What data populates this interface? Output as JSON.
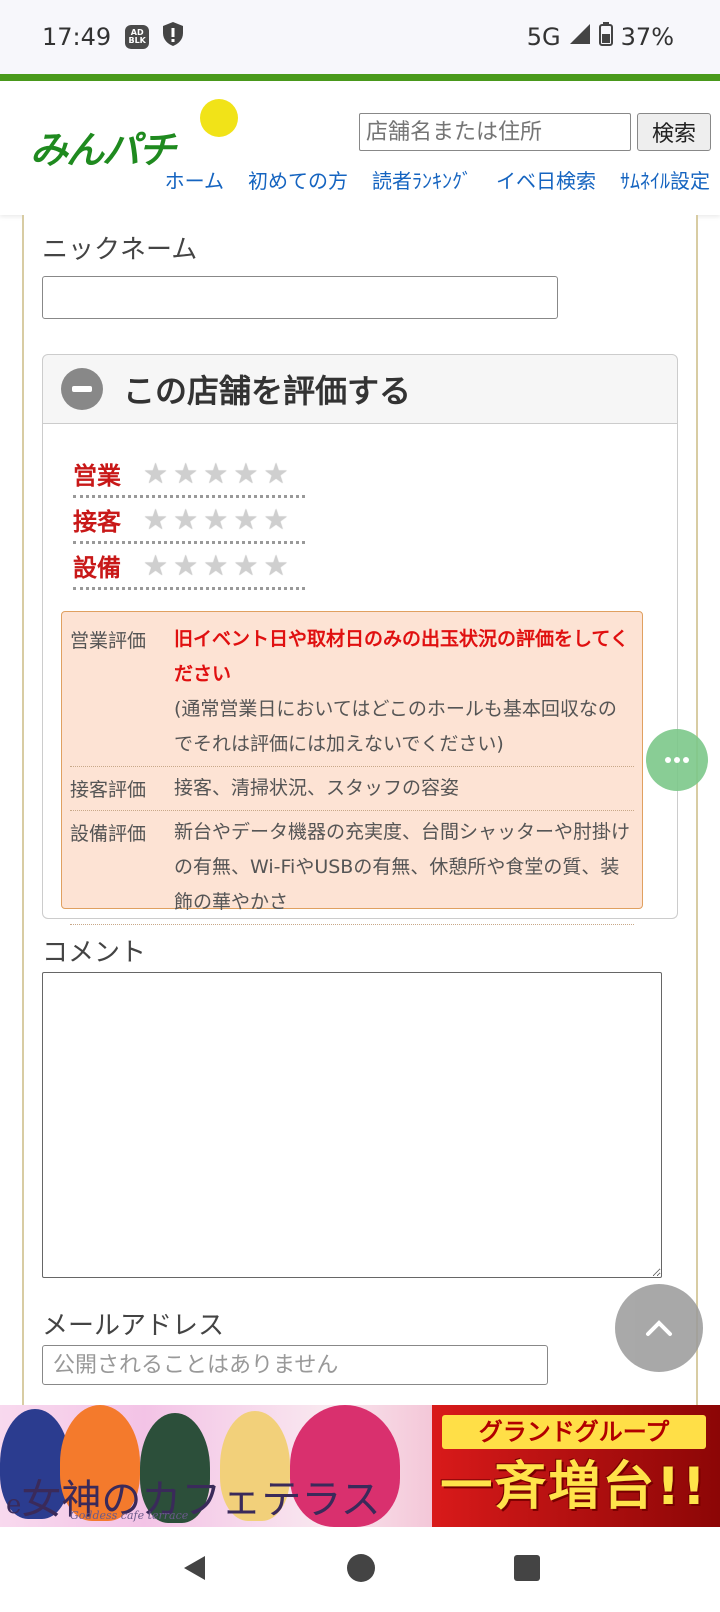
{
  "status_bar": {
    "time": "17:49",
    "network": "5G",
    "battery": "37%",
    "icons": [
      "ad-blocker-icon",
      "shield-icon",
      "signal-icon",
      "battery-icon"
    ]
  },
  "header": {
    "logo_text": "みんパチ",
    "search": {
      "placeholder": "店舗名または住所",
      "button_label": "検索"
    },
    "nav": [
      "ホーム",
      "初めての方",
      "読者ﾗﾝｷﾝｸﾞ",
      "イベ日検索",
      "ｻﾑﾈｲﾙ設定"
    ]
  },
  "form": {
    "nickname_label": "ニックネーム",
    "nickname_value": "",
    "rating_section": {
      "title": "この店舗を評価する",
      "rows": [
        {
          "label": "営業",
          "stars": 0,
          "max": 5
        },
        {
          "label": "接客",
          "stars": 0,
          "max": 5
        },
        {
          "label": "設備",
          "stars": 0,
          "max": 5
        }
      ],
      "guide": {
        "eigyo_key": "営業評価",
        "eigyo_highlight": "旧イベント日や取材日のみの出玉状況の評価をしてください",
        "eigyo_note": "(通常営業日においてはどこのホールも基本回収なのでそれは評価には加えないでください)",
        "sekkyaku_key": "接客評価",
        "sekkyaku_value": "接客、清掃状況、スタッフの容姿",
        "setsubi_key": "設備評価",
        "setsubi_value": "新台やデータ機器の充実度、台間シャッターや肘掛けの有無、Wi-FiやUSBの有無、休憩所や食堂の質、装飾の華やかさ"
      }
    },
    "comment_label": "コメント",
    "email_label": "メールアドレス",
    "email_placeholder": "公開されることはありません"
  },
  "ad": {
    "left_title": "女神のカフェテラス",
    "left_prefix": "e",
    "left_subtitle": "Goddess cafe terrace",
    "right_top": "グランドグループ",
    "right_main": "一斉増台!!"
  },
  "colors": {
    "brand_green": "#4a9a1c",
    "link_blue": "#1564c0",
    "rating_red": "#c81818",
    "guide_bg": "#fde3d4"
  }
}
